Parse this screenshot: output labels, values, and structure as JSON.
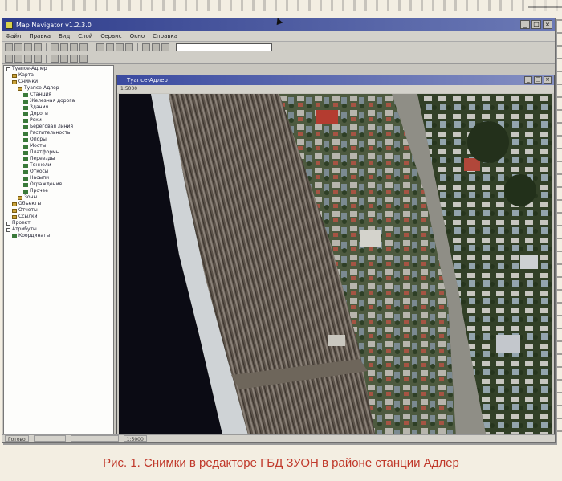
{
  "window": {
    "title": "Map Navigator v1.2.3.0",
    "controls": [
      "_",
      "□",
      "×"
    ]
  },
  "menu": [
    "Файл",
    "Правка",
    "Вид",
    "Слой",
    "Сервис",
    "Окно",
    "Справка"
  ],
  "toolbar": {
    "icons": [
      "new-icon",
      "open-icon",
      "save-icon",
      "print-icon",
      "cut-icon",
      "copy-icon",
      "paste-icon",
      "zoom-in-icon",
      "zoom-out-icon",
      "pan-icon",
      "select-icon",
      "measure-icon",
      "info-icon",
      "layers-icon",
      "refresh-icon"
    ],
    "icons2": [
      "pointer-icon",
      "rect-icon",
      "poly-icon",
      "line-icon",
      "point-icon",
      "text-icon",
      "edit-icon",
      "delete-icon"
    ]
  },
  "image_window": {
    "title": "Туапсе-Адлер",
    "subtitle": "1:5000"
  },
  "tree": [
    {
      "level": 0,
      "kind": "node",
      "label": "Туапсе-Адлер"
    },
    {
      "level": 1,
      "kind": "folder",
      "label": "Карта"
    },
    {
      "level": 1,
      "kind": "folder",
      "label": "Снимки"
    },
    {
      "level": 2,
      "kind": "folder",
      "label": "Туапсе-Адлер"
    },
    {
      "level": 3,
      "kind": "layer",
      "label": "Станция"
    },
    {
      "level": 3,
      "kind": "layer",
      "label": "Железная дорога"
    },
    {
      "level": 3,
      "kind": "layer",
      "label": "Здания"
    },
    {
      "level": 3,
      "kind": "layer",
      "label": "Дороги"
    },
    {
      "level": 3,
      "kind": "layer",
      "label": "Реки"
    },
    {
      "level": 3,
      "kind": "layer",
      "label": "Береговая линия"
    },
    {
      "level": 3,
      "kind": "layer",
      "label": "Растительность"
    },
    {
      "level": 3,
      "kind": "layer",
      "label": "Опоры"
    },
    {
      "level": 3,
      "kind": "layer",
      "label": "Мосты"
    },
    {
      "level": 3,
      "kind": "layer",
      "label": "Платформы"
    },
    {
      "level": 3,
      "kind": "layer",
      "label": "Переезды"
    },
    {
      "level": 3,
      "kind": "layer",
      "label": "Тоннели"
    },
    {
      "level": 3,
      "kind": "layer",
      "label": "Откосы"
    },
    {
      "level": 3,
      "kind": "layer",
      "label": "Насыпи"
    },
    {
      "level": 3,
      "kind": "layer",
      "label": "Ограждения"
    },
    {
      "level": 3,
      "kind": "layer",
      "label": "Прочее"
    },
    {
      "level": 2,
      "kind": "folder",
      "label": "Зоны"
    },
    {
      "level": 1,
      "kind": "folder",
      "label": "Объекты"
    },
    {
      "level": 1,
      "kind": "folder",
      "label": "Отчеты"
    },
    {
      "level": 1,
      "kind": "folder",
      "label": "Ссылки"
    },
    {
      "level": 0,
      "kind": "node",
      "label": "Проект"
    },
    {
      "level": 0,
      "kind": "node",
      "label": "Атрибуты"
    },
    {
      "level": 1,
      "kind": "layer",
      "label": "Координаты"
    }
  ],
  "status": [
    "Готово",
    "",
    "",
    "1:5000"
  ],
  "caption": "Рис. 1. Снимки в редакторе ГБД ЗУОН в районе станции Адлер",
  "colors": {
    "title_bar": "#2f3d8c",
    "caption": "#c0392b",
    "sea": "#0b0b14"
  }
}
